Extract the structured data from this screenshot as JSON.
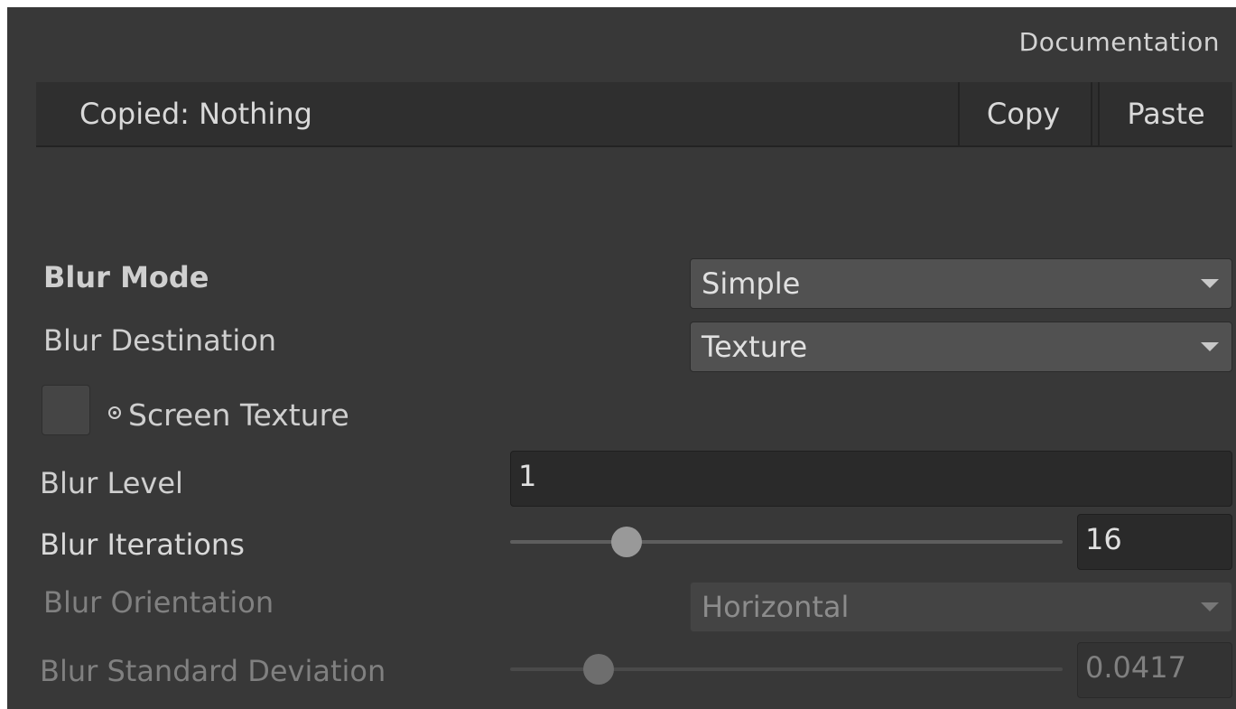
{
  "header": {
    "documentation_label": "Documentation"
  },
  "copy_bar": {
    "status_text": "Copied: Nothing",
    "copy_label": "Copy",
    "paste_label": "Paste"
  },
  "fields": {
    "blur_mode": {
      "label": "Blur Mode",
      "value": "Simple"
    },
    "blur_destination": {
      "label": "Blur Destination",
      "value": "Texture"
    },
    "screen_texture": {
      "label": "Screen Texture",
      "checked": false
    },
    "blur_level": {
      "label": "Blur Level",
      "value": "1"
    },
    "blur_iterations": {
      "label": "Blur Iterations",
      "value": "16",
      "slider_fraction": 0.21
    },
    "blur_orientation": {
      "label": "Blur Orientation",
      "value": "Horizontal",
      "disabled": true
    },
    "blur_std_dev": {
      "label": "Blur Standard Deviation",
      "value": "0.0417",
      "slider_fraction": 0.16,
      "disabled": true
    }
  },
  "icons": {
    "dropdown_arrow": "triangle-down",
    "screen_texture_object": "object-picker-circle"
  },
  "colors": {
    "panel_background": "#383838",
    "dropdown_background": "#515151",
    "input_background": "#2a2a2a",
    "slider_thumb": "#999999"
  }
}
